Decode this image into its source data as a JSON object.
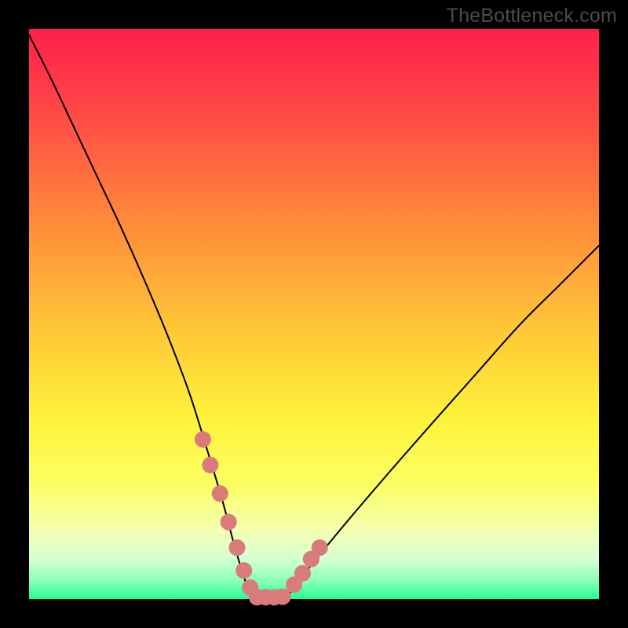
{
  "watermark": "TheBottleneck.com",
  "gradient": {
    "stops": [
      {
        "pct": 0,
        "color": "#ff1f4b"
      },
      {
        "pct": 14,
        "color": "#ff4747"
      },
      {
        "pct": 34,
        "color": "#ff8b3a"
      },
      {
        "pct": 52,
        "color": "#ffc538"
      },
      {
        "pct": 68,
        "color": "#fff23a"
      },
      {
        "pct": 80,
        "color": "#fcff62"
      },
      {
        "pct": 88,
        "color": "#f2ffb1"
      },
      {
        "pct": 93,
        "color": "#d6ffd3"
      },
      {
        "pct": 97,
        "color": "#85ffb6"
      },
      {
        "pct": 100,
        "color": "#22ff94"
      }
    ]
  },
  "chart_data": {
    "type": "line",
    "title": "",
    "xlabel": "",
    "ylabel": "",
    "xlim": [
      0,
      100
    ],
    "ylim": [
      0,
      100
    ],
    "series": [
      {
        "name": "left-curve",
        "x": [
          0,
          4,
          8,
          12,
          16,
          20,
          24,
          28,
          31,
          34,
          36,
          38,
          39.5
        ],
        "y": [
          99,
          91,
          82.5,
          74,
          65.5,
          56.5,
          47,
          36.5,
          27,
          17,
          9.5,
          3,
          0
        ]
      },
      {
        "name": "right-curve",
        "x": [
          45,
          48,
          52,
          57,
          63,
          70,
          78,
          86,
          93,
          100
        ],
        "y": [
          0,
          4,
          9,
          15,
          22,
          30,
          39,
          48,
          55,
          62
        ]
      },
      {
        "name": "bottom-flat",
        "x": [
          39.5,
          45
        ],
        "y": [
          0,
          0
        ]
      }
    ],
    "highlights": [
      {
        "name": "left-lower",
        "x": [
          30.5,
          31.8,
          33.5,
          35,
          36.5,
          37.7,
          38.8
        ],
        "y": [
          28,
          23.5,
          18.5,
          13.5,
          9,
          5,
          2
        ]
      },
      {
        "name": "floor",
        "x": [
          40,
          41.5,
          43,
          44.5
        ],
        "y": [
          0.3,
          0.3,
          0.3,
          0.4
        ]
      },
      {
        "name": "right-lower",
        "x": [
          46.5,
          48,
          49.5,
          51
        ],
        "y": [
          2.5,
          4.5,
          7,
          9
        ]
      }
    ],
    "marker_color": "#d97b7b",
    "marker_radius_pct": 1.45
  }
}
